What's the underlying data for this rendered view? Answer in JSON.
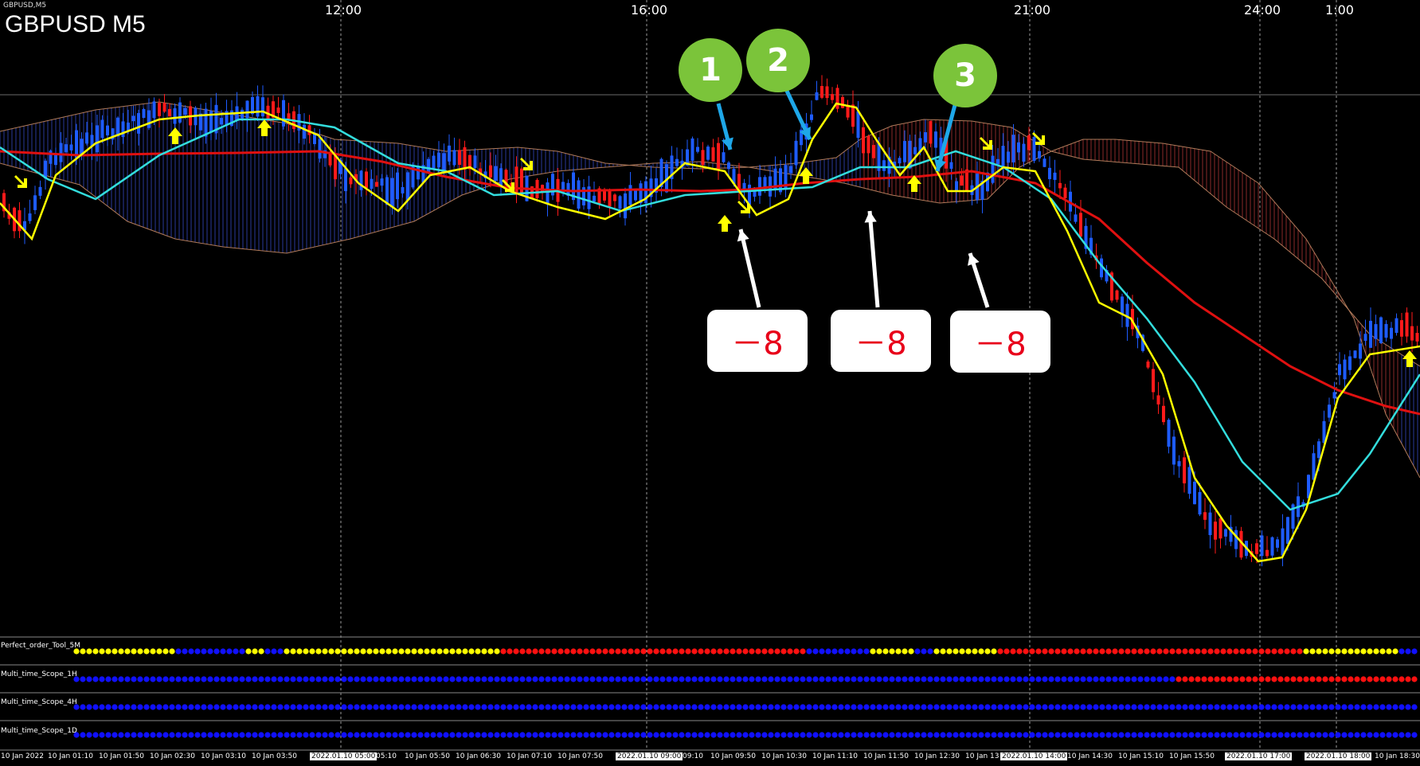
{
  "window": {
    "small_title": "GBPUSD,M5",
    "title": "GBPUSD M5"
  },
  "top_axis": [
    "12:00",
    "16:00",
    "21:00",
    "24:00",
    "1:00"
  ],
  "annotations": {
    "badges": [
      "1",
      "2",
      "3"
    ],
    "loss_labels": [
      "－8",
      "－8",
      "－8"
    ]
  },
  "subwindows": [
    "Perfect_order_Tool_5M",
    "Multi_time_Scope_1H",
    "Multi_time_Scope_4H",
    "Multi_time_Scope_1D"
  ],
  "bottom_axis": [
    "10 Jan 2022",
    "10 Jan 01:10",
    "10 Jan 01:50",
    "10 Jan 02:30",
    "10 Jan 03:10",
    "10 Jan 03:50",
    "2022.01.10 05:00",
    "05:10",
    "10 Jan 05:50",
    "10 Jan 06:30",
    "10 Jan 07:10",
    "10 Jan 07:50",
    "2022.01.10 09:00",
    "09:10",
    "10 Jan 09:50",
    "10 Jan 10:30",
    "10 Jan 11:10",
    "10 Jan 11:50",
    "10 Jan 12:30",
    "10 Jan 13",
    "2022.01.10 14:00",
    "10 Jan 14:30",
    "10 Jan 15:10",
    "10 Jan 15:50",
    "2022.01.10 17:00",
    "2022.01.10 18:00",
    "10 Jan 18:30"
  ],
  "colors": {
    "background": "#000000",
    "bull_candle": "#1e5cff",
    "bear_candle": "#ff1a1a",
    "ma_fast": "#ffff00",
    "ma_mid": "#33dddd",
    "ma_slow": "#e01010",
    "badge": "#7bc43a",
    "annotation_arrow_blue": "#1ea7e8",
    "annotation_arrow_white": "#ffffff",
    "dot_yellow": "#ffff00",
    "dot_blue": "#1010ff",
    "dot_red": "#ff1010"
  },
  "icons": [
    "up-arrow-icon",
    "down-right-arrow-icon"
  ]
}
